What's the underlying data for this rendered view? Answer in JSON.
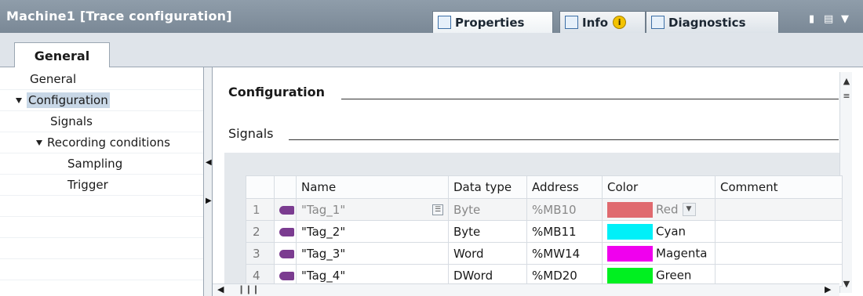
{
  "window": {
    "title": "Machine1 [Trace configuration]",
    "tabs": [
      {
        "label": "Properties",
        "icon": "properties-icon",
        "active": true
      },
      {
        "label": "Info",
        "icon": "info-icon",
        "badge": "i"
      },
      {
        "label": "Diagnostics",
        "icon": "diagnostics-icon"
      }
    ]
  },
  "section_tab": "General",
  "nav": {
    "items": [
      {
        "label": "General"
      },
      {
        "label": "Configuration",
        "expanded": true,
        "selected": true
      },
      {
        "label": "Signals"
      },
      {
        "label": "Recording conditions",
        "expanded": true
      },
      {
        "label": "Sampling"
      },
      {
        "label": "Trigger"
      }
    ]
  },
  "main": {
    "heading": "Configuration",
    "subheading": "Signals",
    "table": {
      "columns": [
        "Name",
        "Data type",
        "Address",
        "Color",
        "Comment"
      ],
      "rows": [
        {
          "num": "1",
          "name": "\"Tag_1\"",
          "type": "Byte",
          "address": "%MB10",
          "color_name": "Red",
          "color": "#e06a6f"
        },
        {
          "num": "2",
          "name": "\"Tag_2\"",
          "type": "Byte",
          "address": "%MB11",
          "color_name": "Cyan",
          "color": "#00f0f8"
        },
        {
          "num": "3",
          "name": "\"Tag_3\"",
          "type": "Word",
          "address": "%MW14",
          "color_name": "Magenta",
          "color": "#f000ee"
        },
        {
          "num": "4",
          "name": "\"Tag_4\"",
          "type": "DWord",
          "address": "%MD20",
          "color_name": "Green",
          "color": "#00f020"
        }
      ]
    }
  },
  "colors": {
    "titlebar": "#8494a3",
    "selection": "#c8d7e6",
    "tag_icon": "#7b3c90"
  }
}
